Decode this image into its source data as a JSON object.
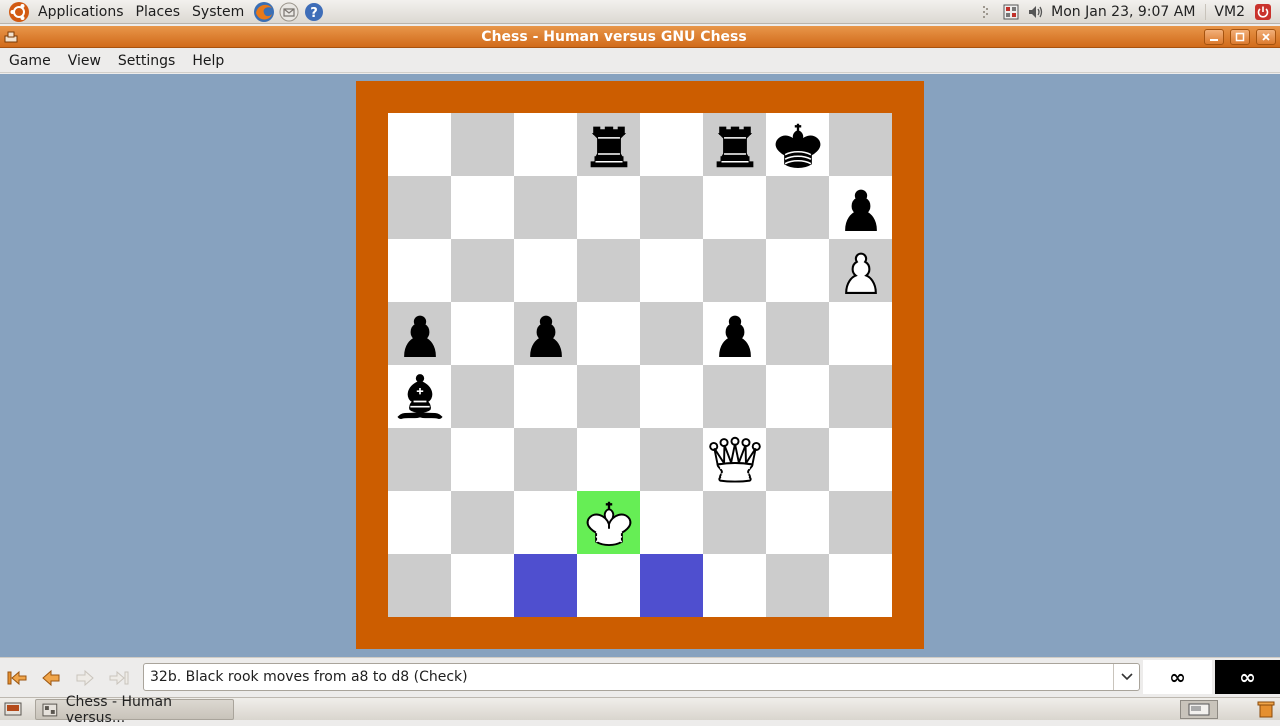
{
  "top_panel": {
    "menus": [
      "Applications",
      "Places",
      "System"
    ],
    "clock": "Mon Jan 23,  9:07 AM",
    "vm_label": "VM2"
  },
  "window": {
    "title": "Chess - Human versus GNU Chess"
  },
  "menubar": [
    "Game",
    "View",
    "Settings",
    "Help"
  ],
  "board": {
    "ranks": [
      [
        "",
        "",
        "",
        "black-rook",
        "",
        "black-rook",
        "black-king",
        ""
      ],
      [
        "",
        "",
        "",
        "",
        "",
        "",
        "",
        "black-pawn"
      ],
      [
        "",
        "",
        "",
        "",
        "",
        "",
        "",
        "white-pawn"
      ],
      [
        "black-pawn",
        "",
        "black-pawn",
        "",
        "",
        "black-pawn",
        "",
        ""
      ],
      [
        "black-bishop",
        "",
        "",
        "",
        "",
        "",
        "",
        ""
      ],
      [
        "",
        "",
        "",
        "",
        "",
        "white-queen",
        "",
        ""
      ],
      [
        "",
        "",
        "",
        "white-king",
        "",
        "",
        "",
        ""
      ],
      [
        "",
        "",
        "",
        "",
        "",
        "",
        "",
        ""
      ]
    ],
    "highlighted_squares": [
      "c1",
      "e1"
    ],
    "check_square": "d2",
    "colors": {
      "frame": "#cc5d00",
      "light": "#ffffff",
      "dark": "#cccccc",
      "highlight": "#4f4fcf",
      "check": "#66ee55",
      "background": "#87a2bf"
    }
  },
  "bottom_bar": {
    "nav_icons": [
      "go-first-icon",
      "go-back-icon",
      "go-forward-icon",
      "go-last-icon"
    ],
    "move_text": "32b. Black rook moves from a8 to d8 (Check)",
    "white_clock": "∞",
    "black_clock": "∞"
  },
  "taskbar": {
    "task_label": "Chess - Human versus..."
  }
}
